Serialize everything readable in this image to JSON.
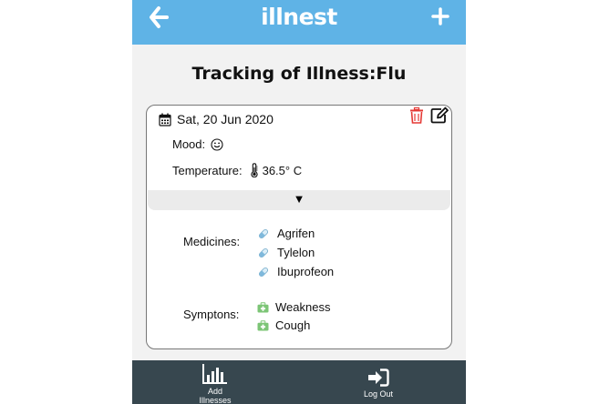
{
  "header": {
    "brand": "illnest",
    "back_icon": "arrow-left-icon",
    "add_icon": "plus-icon",
    "background": "#5fb3e6"
  },
  "page": {
    "title": "Tracking of Illness:Flu"
  },
  "entry": {
    "date": "Sat, 20 Jun 2020",
    "mood_label": "Mood:",
    "mood_icon": "smile-icon",
    "temperature_label": "Temperature:",
    "temperature_value": "36.5° C",
    "toggle_glyph": "▼",
    "medicines_label": "Medicines:",
    "medicines": [
      "Agrifen",
      "Tylelon",
      "Ibuprofeon"
    ],
    "symptoms_label": "Symptons:",
    "symptoms": [
      "Weakness",
      "Cough"
    ],
    "delete_color": "#e53935"
  },
  "nav": {
    "add_label_line1": "Add",
    "add_label_line2": "Illnesses",
    "logout_label": "Log Out",
    "background": "#37474f"
  }
}
